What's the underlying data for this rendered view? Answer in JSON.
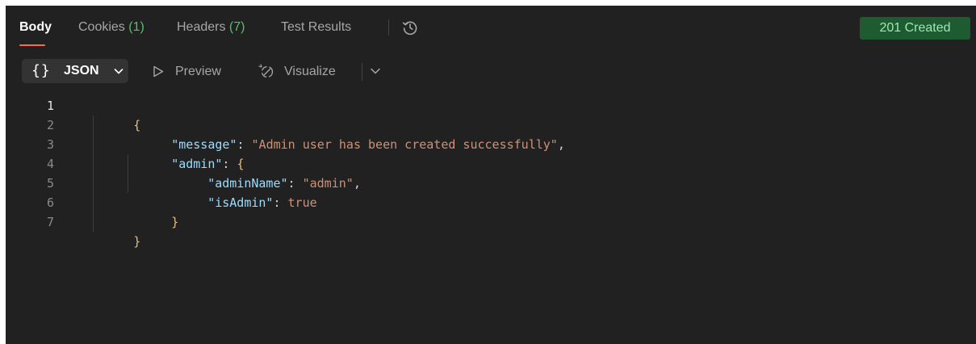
{
  "tabs": [
    {
      "label": "Body",
      "count": ""
    },
    {
      "label": "Cookies ",
      "count": "(1)"
    },
    {
      "label": "Headers ",
      "count": "(7)"
    },
    {
      "label": "Test Results",
      "count": ""
    }
  ],
  "status": {
    "text": "201 Created",
    "color": "#1f5b31"
  },
  "toolbar": {
    "format_icon": "{}",
    "format_label": "JSON",
    "preview_label": "Preview",
    "visualize_label": "Visualize"
  },
  "icons": {
    "history": "history-icon",
    "preview": "play-outline-icon",
    "visualize": "visualize-icon",
    "dropdown": "chevron-down-icon"
  },
  "code": {
    "line_numbers": [
      "1",
      "2",
      "3",
      "4",
      "5",
      "6",
      "7"
    ],
    "l1": "{",
    "l2_key": "\"message\"",
    "l2_sep": ": ",
    "l2_val": "\"Admin user has been created successfully\"",
    "l2_end": ",",
    "l3_key": "\"admin\"",
    "l3_sep": ": ",
    "l3_brace": "{",
    "l4_key": "\"adminName\"",
    "l4_sep": ": ",
    "l4_val": "\"admin\"",
    "l4_end": ",",
    "l5_key": "\"isAdmin\"",
    "l5_sep": ": ",
    "l5_val": "true",
    "l6": "}",
    "l7": "}"
  }
}
